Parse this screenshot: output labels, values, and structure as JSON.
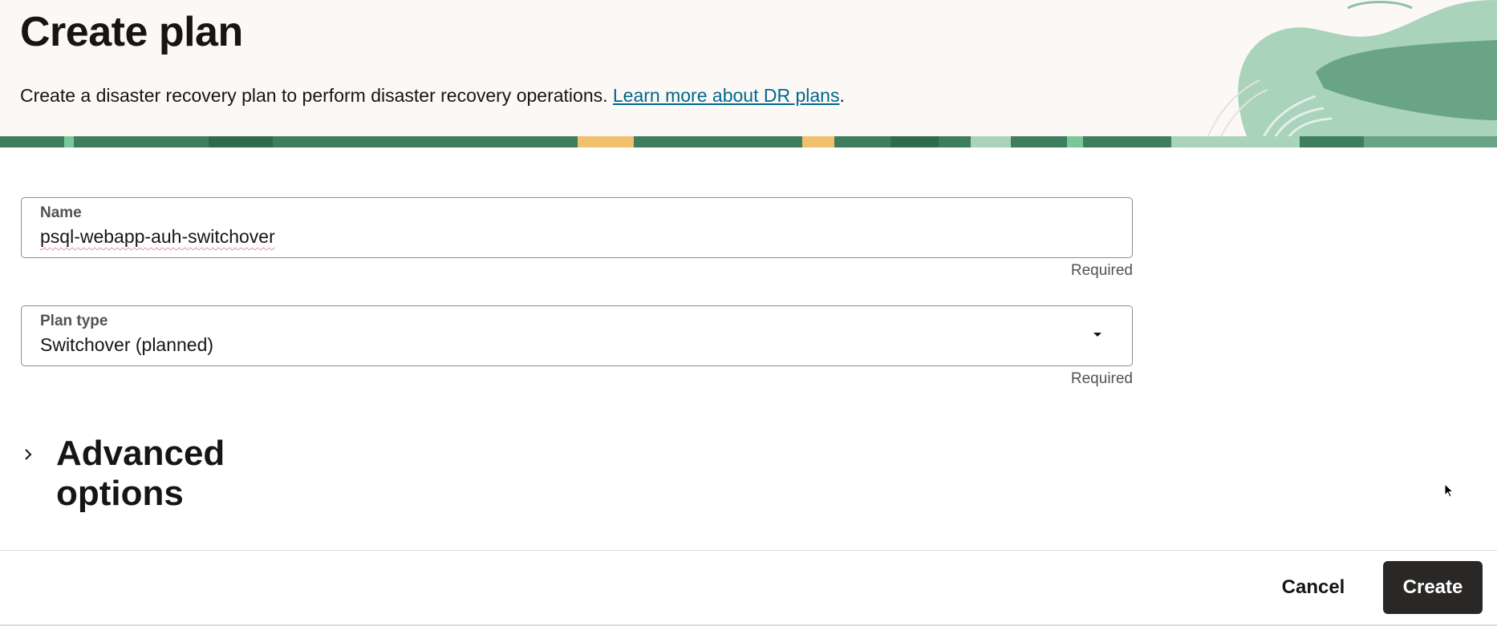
{
  "header": {
    "title": "Create plan",
    "description": "Create a disaster recovery plan to perform disaster recovery operations. ",
    "learn_more_link": "Learn more about DR plans",
    "after_link": "."
  },
  "form": {
    "name": {
      "label": "Name",
      "value": "psql-webapp-auh-switchover",
      "hint": "Required"
    },
    "plan_type": {
      "label": "Plan type",
      "value": "Switchover (planned)",
      "hint": "Required"
    },
    "advanced_options": {
      "label": "Advanced options",
      "expanded": false
    }
  },
  "footer": {
    "cancel_label": "Cancel",
    "create_label": "Create"
  },
  "colors": {
    "accent_link": "#00688c",
    "primary_button": "#2a2826",
    "header_bg": "#fbf8f6",
    "decor_green": "#3e7d5f"
  },
  "icons": {
    "dropdown": "chevron-down-icon",
    "expand": "chevron-right-icon",
    "cursor": "pointer-cursor-icon"
  }
}
